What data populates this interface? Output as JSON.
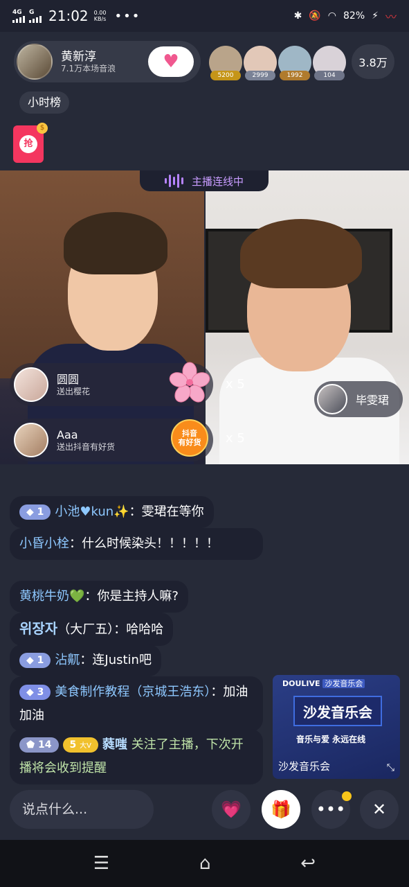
{
  "status_bar": {
    "signal1": "4G",
    "signal2": "G",
    "time": "21:02",
    "net_speed_value": "0.00",
    "net_speed_unit": "KB/s",
    "overflow": "•••",
    "battery": "82%"
  },
  "host": {
    "name": "黄新淳",
    "fans": "7.1万本场音浪",
    "follow_icon": "heart-icon"
  },
  "audience": [
    {
      "count": "5200",
      "color": "#c59518",
      "avatar": "#b9a48a"
    },
    {
      "count": "2999",
      "color": "#7a8296",
      "avatar": "#e2c8b8"
    },
    {
      "count": "1992",
      "color": "#b07b2d",
      "avatar": "#9fb7c6"
    },
    {
      "count": "104",
      "color": "#6e7488",
      "avatar": "#d9d2d8"
    }
  ],
  "viewers": "3.8万",
  "tag": "小时榜",
  "redpack": {
    "label": "抢",
    "dot": "$"
  },
  "pk_label": "主播连线中",
  "gifts": [
    {
      "name": "圆圆",
      "desc": "送出樱花",
      "multiplier": "x 5",
      "icon": "cherry-blossom-icon"
    },
    {
      "name": "Aaa",
      "desc": "送出抖音有好货",
      "multiplier": "x 5",
      "icon": "douyin-good-goods-icon",
      "icon_text_1": "抖音",
      "icon_text_2": "有好货"
    }
  ],
  "guest": {
    "name": "毕雯珺"
  },
  "chat": [
    {
      "badge": "1",
      "user": "小池♥kun✨",
      "text": "：雯珺在等你"
    },
    {
      "user": "小昏小栓",
      "text": "：什么时候染头！！！！！"
    },
    {
      "user": "黄桃牛奶💚",
      "text": "：你是主持人嘛?"
    },
    {
      "user": "위장자",
      "text": "（大厂五）：哈哈哈"
    },
    {
      "badge": "1",
      "user": "沾鼿",
      "text": "：连Justin吧"
    },
    {
      "badge": "3",
      "user": "美食制作教程（京城王浩东）",
      "text": "：加油加油"
    },
    {
      "badge": "14",
      "badge2": "5",
      "badge2_text": "大V",
      "user": "蕤嗤",
      "text": " 关注了主播，下次开播将会收到提醒"
    }
  ],
  "promo": {
    "brand": "DOULIVE",
    "brand_tag": "沙发音乐会",
    "title": "沙发音乐会",
    "subtitle": "音乐与爱 永远在线",
    "footer": "沙发音乐会"
  },
  "bottom": {
    "input_placeholder": "说点什么...",
    "more": "•••",
    "close": "✕"
  }
}
